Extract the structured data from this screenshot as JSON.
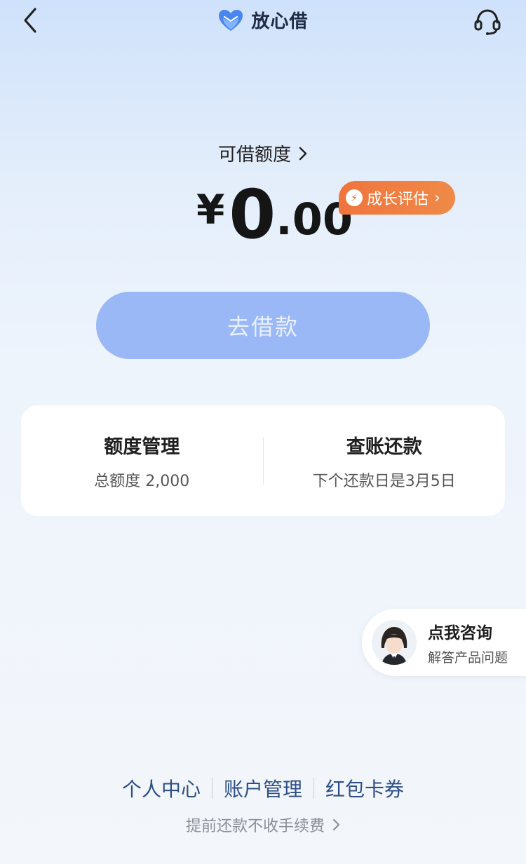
{
  "header": {
    "app_name": "放心借",
    "back_icon": "chevron-left-icon",
    "service_icon": "headset-icon"
  },
  "quota": {
    "label": "可借额度",
    "currency": "¥",
    "amount_int": "0",
    "amount_dec": ".00"
  },
  "growth_badge": {
    "label": "成长评估",
    "icon": "lightning-icon",
    "color": "#f0743c"
  },
  "borrow_button": {
    "label": "去借款",
    "color": "#9bb8f6"
  },
  "cards": {
    "limit": {
      "title": "额度管理",
      "subtitle": "总额度 2,000"
    },
    "billing": {
      "title": "查账还款",
      "subtitle": "下个还款日是3月5日"
    }
  },
  "consult": {
    "title": "点我咨询",
    "subtitle": "解答产品问题"
  },
  "bottom_links": {
    "personal": "个人中心",
    "account": "账户管理",
    "coupons": "红包卡券"
  },
  "fee_note": "提前还款不收手续费"
}
